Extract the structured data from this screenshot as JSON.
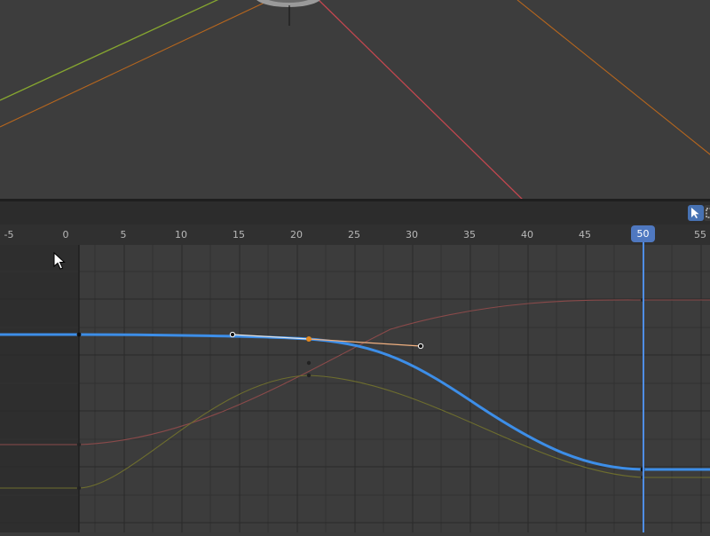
{
  "viewport": {
    "axis_colors": {
      "x_axis": "#c3474f",
      "y_axis": "#86a630",
      "helper": "#b6661e"
    }
  },
  "graph_editor": {
    "toolbar": {
      "select_tool_icon": "select-cursor-icon",
      "frame_tool_icon": "frame-select-icon"
    },
    "ruler": {
      "labels": [
        "-5",
        "0",
        "5",
        "10",
        "15",
        "20",
        "25",
        "30",
        "35",
        "40",
        "45",
        "50",
        "55"
      ]
    },
    "current_frame": "50",
    "colors": {
      "active_curve": "#3d8ee8",
      "x_location_curve": "#8a4a4a",
      "y_location_curve": "#6e6e2e",
      "selected_keyframe": "#e58a1f",
      "playhead": "#4f8ee5"
    }
  }
}
